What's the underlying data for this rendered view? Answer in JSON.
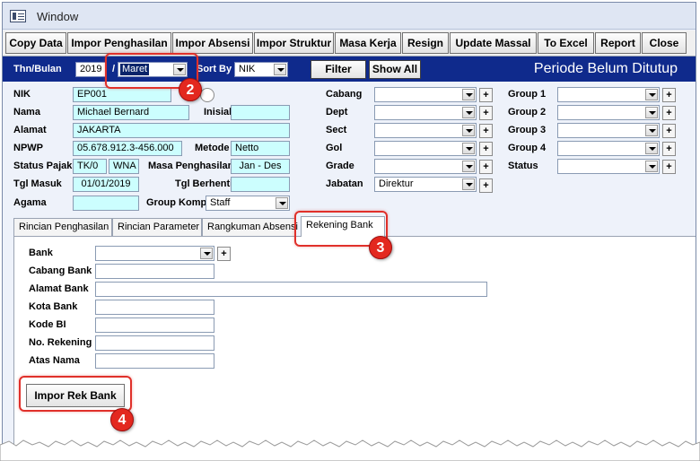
{
  "window": {
    "title": "Window"
  },
  "toolbar": {
    "buttons": [
      "Copy Data",
      "Impor Penghasilan",
      "Impor Absensi",
      "Impor Struktur",
      "Masa Kerja",
      "Resign",
      "Update Massal",
      "To Excel",
      "Report",
      "Close"
    ]
  },
  "nav": {
    "year_label": "Thn/Bulan",
    "year": "2019",
    "slash": "/",
    "month": "Maret",
    "sort_label": "Sort By",
    "sort_value": "NIK",
    "filter": "Filter",
    "show_all": "Show All",
    "period_title": "Periode Belum Ditutup"
  },
  "employee": {
    "nik_label": "NIK",
    "nik": "EP001",
    "nama_label": "Nama",
    "nama": "Michael Bernard",
    "inisial_label": "Inisial",
    "inisial": "",
    "alamat_label": "Alamat",
    "alamat": "JAKARTA",
    "npwp_label": "NPWP",
    "npwp": "05.678.912.3-456.000",
    "metode_label": "Metode",
    "metode": "Netto",
    "status_pajak_label": "Status Pajak",
    "status_pajak": "TK/0",
    "status_wna": "WNA",
    "masa_label": "Masa Penghasilan",
    "masa": "Jan - Des",
    "tgl_masuk_label": "Tgl Masuk",
    "tgl_masuk": "01/01/2019",
    "tgl_berhenti_label": "Tgl Berhenti",
    "tgl_berhenti": "",
    "agama_label": "Agama",
    "agama": "",
    "group_komp_label": "Group Komp",
    "group_komp": "Staff"
  },
  "org": {
    "cabang_label": "Cabang",
    "cabang": "",
    "dept_label": "Dept",
    "dept": "",
    "sect_label": "Sect",
    "sect": "",
    "gol_label": "Gol",
    "gol": "",
    "grade_label": "Grade",
    "grade": "",
    "jabatan_label": "Jabatan",
    "jabatan": "Direktur"
  },
  "groups": {
    "group1_label": "Group 1",
    "group2_label": "Group 2",
    "group3_label": "Group 3",
    "group4_label": "Group 4",
    "status_label": "Status"
  },
  "tabs": [
    "Rincian Penghasilan",
    "Rincian Parameter",
    "Rangkuman Absensi",
    "Rekening Bank"
  ],
  "bank": {
    "bank_label": "Bank",
    "cabang_bank_label": "Cabang Bank",
    "alamat_bank_label": "Alamat Bank",
    "kota_bank_label": "Kota Bank",
    "kode_bi_label": "Kode BI",
    "no_rekening_label": "No. Rekening",
    "atas_nama_label": "Atas Nama",
    "impor_button": "Impor Rek Bank"
  },
  "callouts": [
    "2",
    "3",
    "4"
  ],
  "colors": {
    "nav_bg": "#0f2a8c",
    "field_bg": "#ccfefe",
    "callout": "#e0302a"
  }
}
